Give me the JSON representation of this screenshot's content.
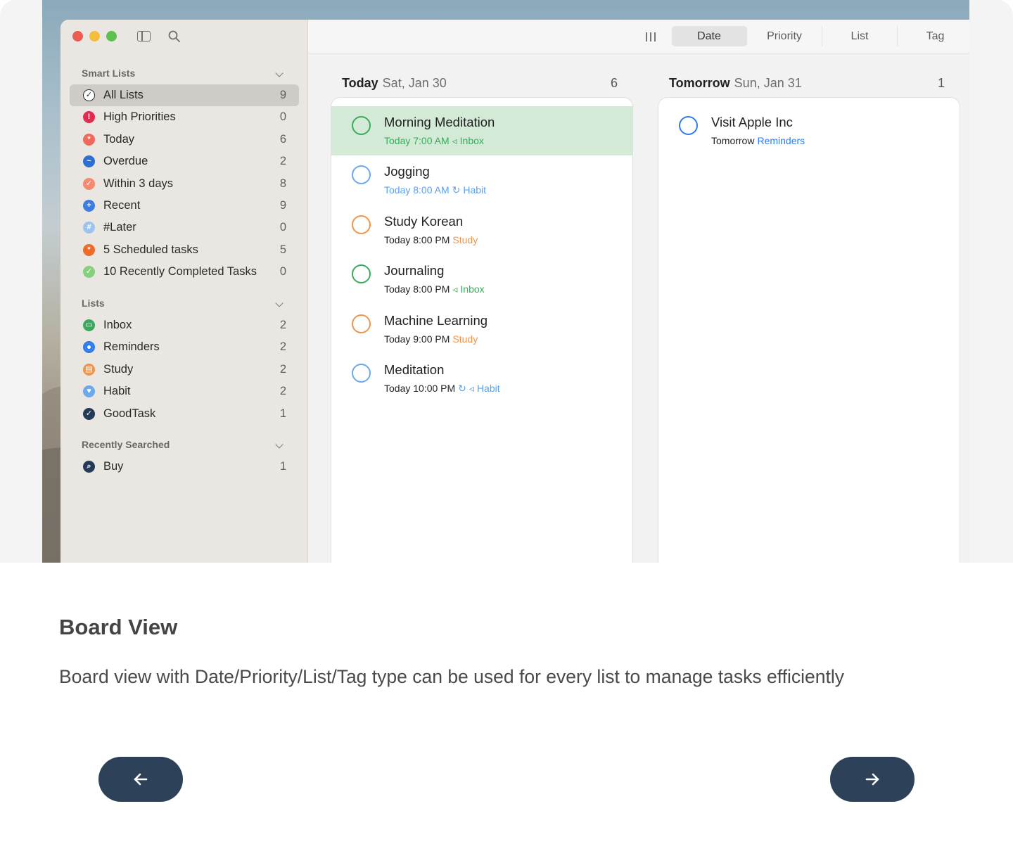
{
  "sidebar": {
    "smart_lists_title": "Smart Lists",
    "smart_lists": [
      {
        "label": "All Lists",
        "count": "9",
        "icon": "check-circle-icon",
        "color": "#2b2b2b"
      },
      {
        "label": "High Priorities",
        "count": "0",
        "icon": "exclamation-icon",
        "color": "#e5294f"
      },
      {
        "label": "Today",
        "count": "6",
        "icon": "asterisk-icon",
        "color": "#ef6a5c"
      },
      {
        "label": "Overdue",
        "count": "2",
        "icon": "wave-icon",
        "color": "#2c6ed2"
      },
      {
        "label": "Within 3 days",
        "count": "8",
        "icon": "check-icon",
        "color": "#f58a73"
      },
      {
        "label": "Recent",
        "count": "9",
        "icon": "plus-icon",
        "color": "#3c7ee0"
      },
      {
        "label": "#Later",
        "count": "0",
        "icon": "hash-icon",
        "color": "#9ec2ee"
      },
      {
        "label": "5 Scheduled tasks",
        "count": "5",
        "icon": "asterisk-icon",
        "color": "#ec6b2d"
      },
      {
        "label": "10 Recently Completed Tasks",
        "count": "0",
        "icon": "check-icon",
        "color": "#86d07f"
      }
    ],
    "lists_title": "Lists",
    "lists": [
      {
        "label": "Inbox",
        "count": "2",
        "icon": "inbox-icon",
        "color": "#3aaa5c"
      },
      {
        "label": "Reminders",
        "count": "2",
        "icon": "dot-icon",
        "color": "#2f7bea"
      },
      {
        "label": "Study",
        "count": "2",
        "icon": "book-icon",
        "color": "#f0944a"
      },
      {
        "label": "Habit",
        "count": "2",
        "icon": "heart-icon",
        "color": "#6ba8ee"
      },
      {
        "label": "GoodTask",
        "count": "1",
        "icon": "check-circle-icon",
        "color": "#253a55"
      }
    ],
    "recent_title": "Recently Searched",
    "recent": [
      {
        "label": "Buy",
        "count": "1",
        "icon": "search-icon",
        "color": "#253a55"
      }
    ]
  },
  "toolbar": {
    "tabs": [
      "Date",
      "Priority",
      "List",
      "Tag"
    ],
    "active_tab": "Date"
  },
  "board": {
    "columns": [
      {
        "title": "Today",
        "date": "Sat, Jan 30",
        "count": "6",
        "tasks": [
          {
            "title": "Morning Meditation",
            "meta": [
              {
                "text": "Today 7:00 AM",
                "color": "#3aaa5c"
              },
              {
                "text": "◃",
                "color": "#3aaa5c"
              },
              {
                "text": "Inbox",
                "color": "#3aaa5c"
              }
            ],
            "circle": "#3aaa5c",
            "highlight": true
          },
          {
            "title": "Jogging",
            "meta": [
              {
                "text": "Today 8:00 AM",
                "color": "#5aa2ec"
              },
              {
                "text": "↻",
                "color": "#5aa2ec"
              },
              {
                "text": "Habit",
                "color": "#5aa2ec"
              }
            ],
            "circle": "#6ba8ee",
            "highlight": false
          },
          {
            "title": "Study Korean",
            "meta": [
              {
                "text": "Today 8:00 PM",
                "color": "#222222"
              },
              {
                "text": "Study",
                "color": "#f0944a"
              }
            ],
            "circle": "#f0944a",
            "highlight": false
          },
          {
            "title": "Journaling",
            "meta": [
              {
                "text": "Today 8:00 PM",
                "color": "#222222"
              },
              {
                "text": "◃",
                "color": "#3aaa5c"
              },
              {
                "text": "Inbox",
                "color": "#3aaa5c"
              }
            ],
            "circle": "#3aaa5c",
            "highlight": false
          },
          {
            "title": "Machine Learning",
            "meta": [
              {
                "text": "Today 9:00 PM",
                "color": "#222222"
              },
              {
                "text": "Study",
                "color": "#f0944a"
              }
            ],
            "circle": "#f0944a",
            "highlight": false
          },
          {
            "title": "Meditation",
            "meta": [
              {
                "text": "Today 10:00 PM",
                "color": "#222222"
              },
              {
                "text": "↻",
                "color": "#5aa2ec"
              },
              {
                "text": "◃",
                "color": "#5aa2ec"
              },
              {
                "text": "Habit",
                "color": "#5aa2ec"
              }
            ],
            "circle": "#6ba8ee",
            "highlight": false
          }
        ]
      },
      {
        "title": "Tomorrow",
        "date": "Sun, Jan 31",
        "count": "1",
        "tasks": [
          {
            "title": "Visit Apple Inc",
            "meta": [
              {
                "text": "Tomorrow",
                "color": "#222222"
              },
              {
                "text": "Reminders",
                "color": "#2f7bea"
              }
            ],
            "circle": "#2f7bea",
            "highlight": false
          }
        ]
      }
    ]
  },
  "caption": {
    "title": "Board View",
    "description": "Board view with Date/Priority/List/Tag type can be used for every list to manage tasks efficiently"
  },
  "nav": {
    "prev_icon": "arrow-left-icon",
    "next_icon": "arrow-right-icon"
  }
}
